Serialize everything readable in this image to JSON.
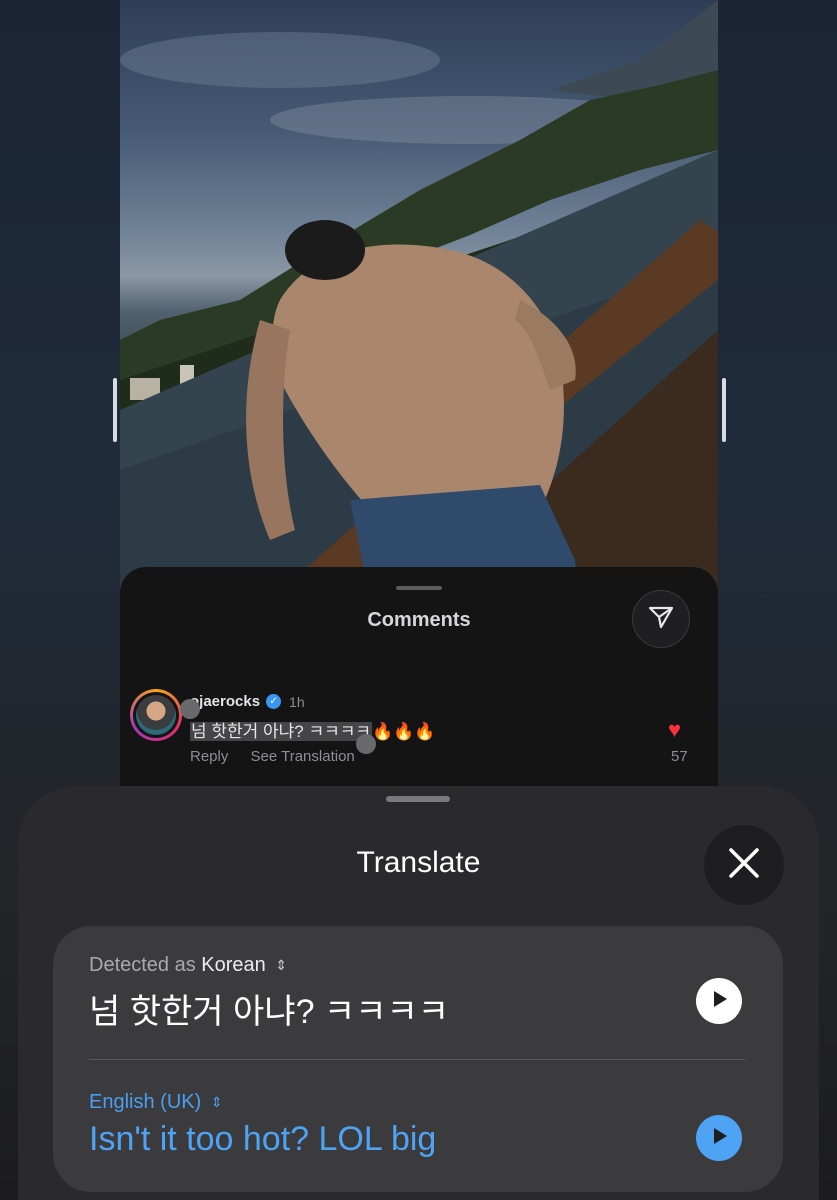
{
  "comments": {
    "title": "Comments",
    "comment": {
      "username": "ojaerocks",
      "time": "1h",
      "text": "넘 핫한거 아냐? ㅋㅋㅋㅋ",
      "emoji": "🔥🔥🔥",
      "reply_label": "Reply",
      "see_translation_label": "See Translation",
      "like_count": "57"
    }
  },
  "translate": {
    "title": "Translate",
    "detected_prefix": "Detected as",
    "source_language": "Korean",
    "source_text": "넘 핫한거 아냐? ㅋㅋㅋㅋ",
    "target_language": "English (UK)",
    "target_text": "Isn't it too hot? LOL big"
  },
  "colors": {
    "accent_blue": "#4ea3f5",
    "like_red": "#ff3040",
    "verified_blue": "#3897f0"
  },
  "icons": [
    "send-icon",
    "verified-icon",
    "heart-icon",
    "close-icon",
    "play-icon",
    "chevron-updown-icon"
  ]
}
